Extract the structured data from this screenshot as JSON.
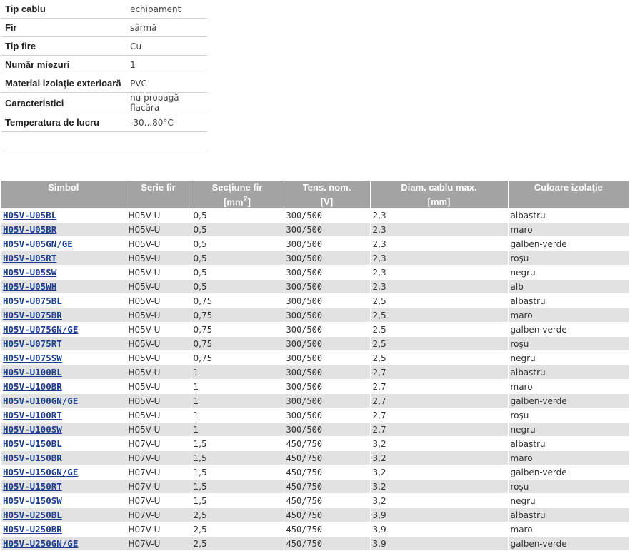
{
  "specs": [
    {
      "label": "Tip cablu",
      "value": "echipament"
    },
    {
      "label": "Fir",
      "value": "sârmă"
    },
    {
      "label": "Tip fire",
      "value": "Cu"
    },
    {
      "label": "Număr miezuri",
      "value": "1"
    },
    {
      "label": "Material izolaţie exterioară",
      "value": "PVC"
    },
    {
      "label": "Caracteristici",
      "value": "nu propagă flacăra"
    },
    {
      "label": "Temperatura de lucru",
      "value": "-30...80°C"
    }
  ],
  "table": {
    "headers": [
      "Simbol",
      "Serie fir",
      "Secţiune fir",
      "Tens. nom.",
      "Diam. cablu max.",
      "Culoare izolaţie"
    ],
    "units": {
      "section_pre": "[mm",
      "section_sup": "2",
      "section_post": "]",
      "voltage": "[V]",
      "diam": "[mm]"
    },
    "rows": [
      [
        "H05V-U05BL",
        "H05V-U",
        "0,5",
        "300/500",
        "2,3",
        "albastru"
      ],
      [
        "H05V-U05BR",
        "H05V-U",
        "0,5",
        "300/500",
        "2,3",
        "maro"
      ],
      [
        "H05V-U05GN/GE",
        "H05V-U",
        "0,5",
        "300/500",
        "2,3",
        "galben-verde"
      ],
      [
        "H05V-U05RT",
        "H05V-U",
        "0,5",
        "300/500",
        "2,3",
        "roşu"
      ],
      [
        "H05V-U05SW",
        "H05V-U",
        "0,5",
        "300/500",
        "2,3",
        "negru"
      ],
      [
        "H05V-U05WH",
        "H05V-U",
        "0,5",
        "300/500",
        "2,3",
        "alb"
      ],
      [
        "H05V-U075BL",
        "H05V-U",
        "0,75",
        "300/500",
        "2,5",
        "albastru"
      ],
      [
        "H05V-U075BR",
        "H05V-U",
        "0,75",
        "300/500",
        "2,5",
        "maro"
      ],
      [
        "H05V-U075GN/GE",
        "H05V-U",
        "0,75",
        "300/500",
        "2,5",
        "galben-verde"
      ],
      [
        "H05V-U075RT",
        "H05V-U",
        "0,75",
        "300/500",
        "2,5",
        "roşu"
      ],
      [
        "H05V-U075SW",
        "H05V-U",
        "0,75",
        "300/500",
        "2,5",
        "negru"
      ],
      [
        "H05V-U100BL",
        "H05V-U",
        "1",
        "300/500",
        "2,7",
        "albastru"
      ],
      [
        "H05V-U100BR",
        "H05V-U",
        "1",
        "300/500",
        "2,7",
        "maro"
      ],
      [
        "H05V-U100GN/GE",
        "H05V-U",
        "1",
        "300/500",
        "2,7",
        "galben-verde"
      ],
      [
        "H05V-U100RT",
        "H05V-U",
        "1",
        "300/500",
        "2,7",
        "roşu"
      ],
      [
        "H05V-U100SW",
        "H05V-U",
        "1",
        "300/500",
        "2,7",
        "negru"
      ],
      [
        "H05V-U150BL",
        "H07V-U",
        "1,5",
        "450/750",
        "3,2",
        "albastru"
      ],
      [
        "H05V-U150BR",
        "H07V-U",
        "1,5",
        "450/750",
        "3,2",
        "maro"
      ],
      [
        "H05V-U150GN/GE",
        "H07V-U",
        "1,5",
        "450/750",
        "3,2",
        "galben-verde"
      ],
      [
        "H05V-U150RT",
        "H07V-U",
        "1,5",
        "450/750",
        "3,2",
        "roşu"
      ],
      [
        "H05V-U150SW",
        "H07V-U",
        "1,5",
        "450/750",
        "3,2",
        "negru"
      ],
      [
        "H05V-U250BL",
        "H07V-U",
        "2,5",
        "450/750",
        "3,9",
        "albastru"
      ],
      [
        "H05V-U250BR",
        "H07V-U",
        "2,5",
        "450/750",
        "3,9",
        "maro"
      ],
      [
        "H05V-U250GN/GE",
        "H07V-U",
        "2,5",
        "450/750",
        "3,9",
        "galben-verde"
      ]
    ]
  },
  "colors": {
    "header_bg": "#a3a3a3",
    "stripe": "#e2e2e2",
    "link": "#1a3d8f"
  }
}
